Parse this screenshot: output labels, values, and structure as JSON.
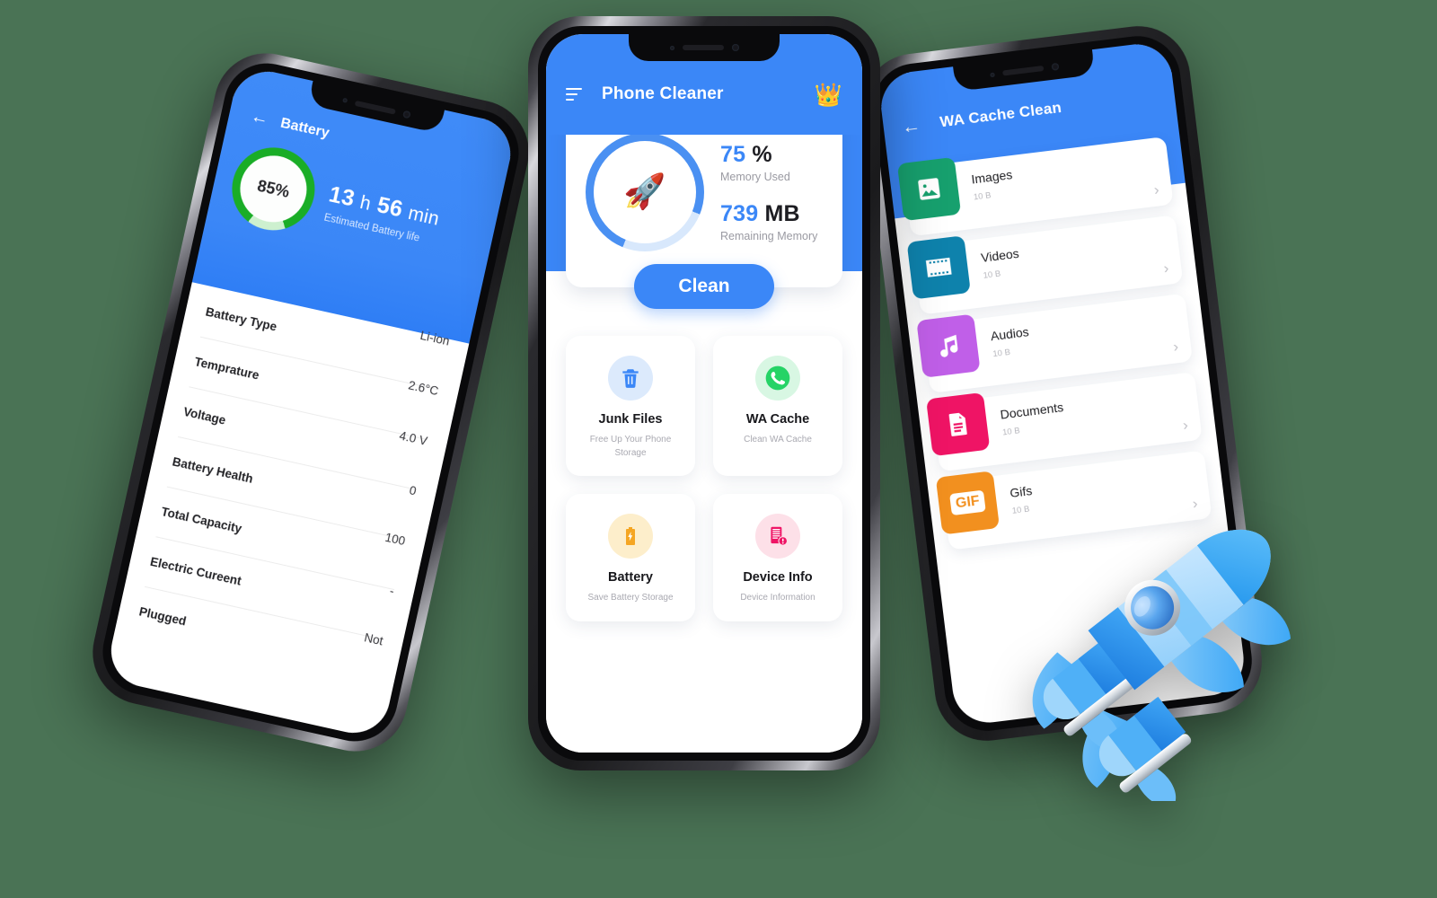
{
  "theme": {
    "background": "#4a7355",
    "primary_blue": "#3b87f7",
    "battery_green": "#1aad27",
    "accent_light_blue": "#d8e8fc"
  },
  "left_phone": {
    "screen_name": "Battery",
    "appbar": {
      "back_icon": "arrow-left-icon",
      "title": "Battery"
    },
    "hero": {
      "ring_percent_label": "85%",
      "ring_percent_value": 85,
      "time_value": "13",
      "time_unit_h": "h",
      "time_minutes": "56",
      "time_unit_min": "min",
      "time_full": "13 h 56 min",
      "subtitle": "Estimated Battery life"
    },
    "rows": [
      {
        "label": "Battery Type",
        "value": "Li-ion"
      },
      {
        "label": "Temprature",
        "value": "2.6°C"
      },
      {
        "label": "Voltage",
        "value": "4.0 V"
      },
      {
        "label": "Battery Health",
        "value": "0"
      },
      {
        "label": "Total Capacity",
        "value": "100"
      },
      {
        "label": "Electric Cureent",
        "value": "-"
      },
      {
        "label": "Plugged",
        "value": "Not"
      }
    ]
  },
  "center_phone": {
    "screen_name": "Phone Cleaner",
    "appbar": {
      "menu_icon": "hamburger-menu-icon",
      "title": "Phone Cleaner",
      "premium_icon": "crown-icon",
      "premium_glyph": "👑"
    },
    "memory_card": {
      "ring_icon": "rocket-icon",
      "ring_glyph": "🚀",
      "ring_percent_value": 75,
      "used_number": "75",
      "used_unit": "%",
      "used_caption": "Memory Used",
      "remaining_number": "739",
      "remaining_unit": "MB",
      "remaining_caption": "Remaining Memory"
    },
    "clean_button": "Clean",
    "tiles": [
      {
        "icon": "trash-icon",
        "title": "Junk Files",
        "subtitle": "Free Up Your Phone Storage"
      },
      {
        "icon": "whatsapp-icon",
        "title": "WA Cache",
        "subtitle": "Clean WA Cache"
      },
      {
        "icon": "battery-bolt-icon",
        "title": "Battery",
        "subtitle": "Save Battery Storage"
      },
      {
        "icon": "device-info-icon",
        "title": "Device Info",
        "subtitle": "Device Information"
      }
    ]
  },
  "right_phone": {
    "screen_name": "WA Cache Clean",
    "appbar": {
      "back_icon": "arrow-left-icon",
      "title": "WA Cache Clean"
    },
    "rows": [
      {
        "icon": "image-icon",
        "name": "Images",
        "size": "10 B",
        "color": "#17a06e",
        "chevron": "›"
      },
      {
        "icon": "video-icon",
        "name": "Videos",
        "size": "10 B",
        "color": "#0e82ac",
        "chevron": "›"
      },
      {
        "icon": "music-icon",
        "name": "Audios",
        "size": "10 B",
        "color": "#c05fe8",
        "chevron": "›"
      },
      {
        "icon": "document-icon",
        "name": "Documents",
        "size": "10 B",
        "color": "#ef1465",
        "chevron": "›"
      },
      {
        "icon": "gif-icon",
        "name": "Gifs",
        "size": "10 B",
        "color": "#f2901f",
        "chevron": "›",
        "badge_text": "GIF"
      }
    ]
  },
  "decoration": {
    "rocket_3d": "rocket-3d-illustration"
  }
}
